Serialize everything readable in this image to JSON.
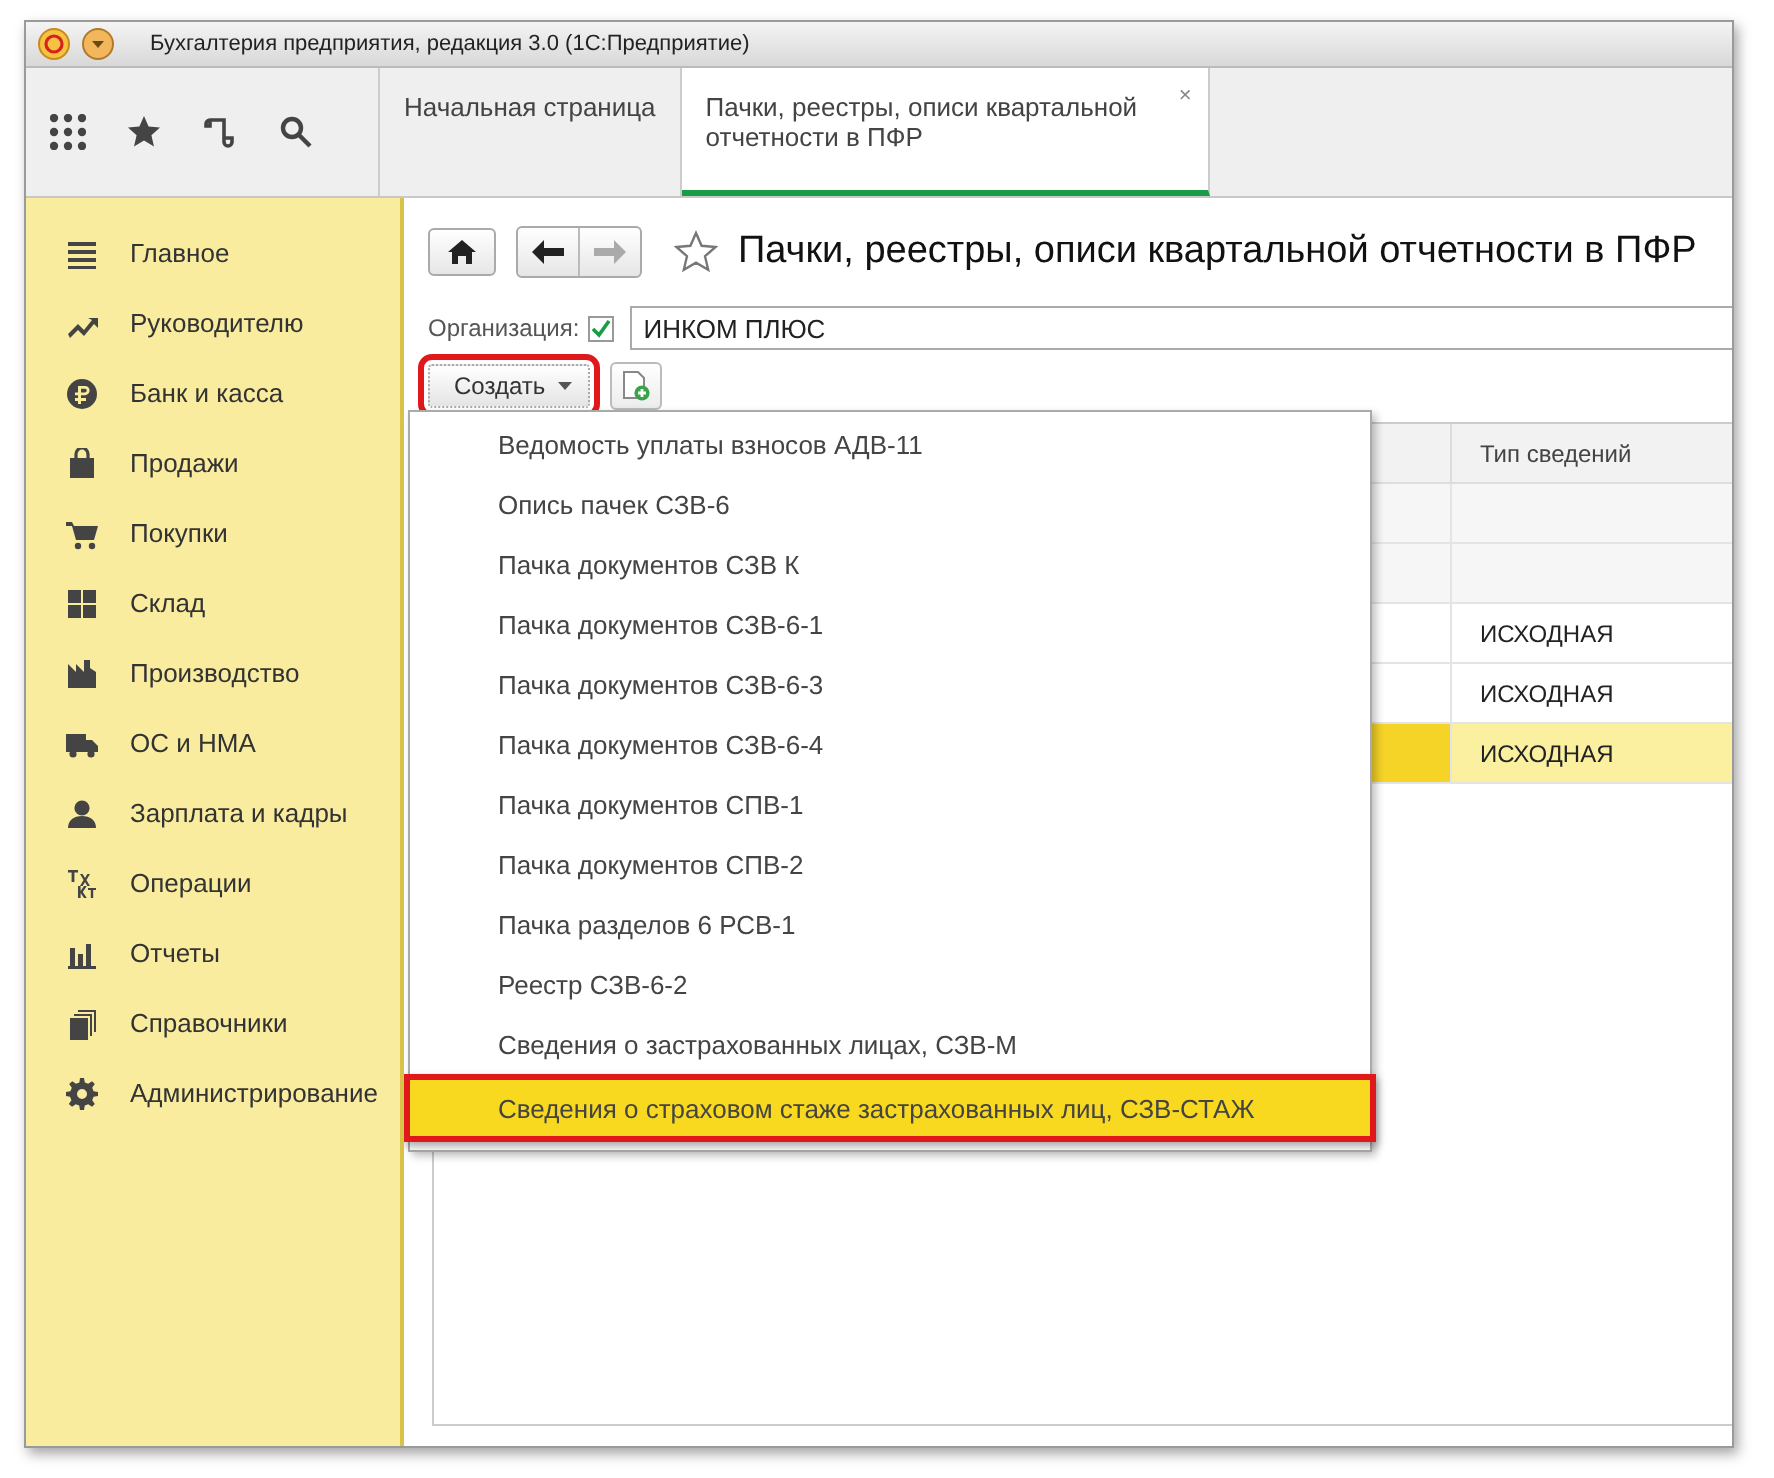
{
  "window": {
    "title": "Бухгалтерия предприятия, редакция 3.0  (1С:Предприятие)"
  },
  "tabs": [
    {
      "label": "Начальная страница",
      "selected": false
    },
    {
      "label": "Пачки, реестры, описи квартальной отчетности в ПФР",
      "selected": true,
      "close": "×"
    }
  ],
  "sidebar": {
    "items": [
      {
        "label": "Главное"
      },
      {
        "label": "Руководителю"
      },
      {
        "label": "Банк и касса"
      },
      {
        "label": "Продажи"
      },
      {
        "label": "Покупки"
      },
      {
        "label": "Склад"
      },
      {
        "label": "Производство"
      },
      {
        "label": "ОС и НМА"
      },
      {
        "label": "Зарплата и кадры"
      },
      {
        "label": "Операции"
      },
      {
        "label": "Отчеты"
      },
      {
        "label": "Справочники"
      },
      {
        "label": "Администрирование"
      }
    ]
  },
  "page": {
    "title": "Пачки, реестры, описи квартальной отчетности в ПФР",
    "favorite": false
  },
  "organization": {
    "label": "Организация:",
    "checked": true,
    "value": "ИНКОМ ПЛЮС"
  },
  "create_button": {
    "label": "Создать",
    "highlighted": true
  },
  "create_menu": [
    {
      "label": "Ведомость уплаты взносов АДВ-11",
      "selected": false
    },
    {
      "label": "Опись пачек СЗВ-6",
      "selected": false
    },
    {
      "label": "Пачка документов СЗВ К",
      "selected": false
    },
    {
      "label": "Пачка документов СЗВ-6-1",
      "selected": false
    },
    {
      "label": "Пачка документов СЗВ-6-3",
      "selected": false
    },
    {
      "label": "Пачка документов СЗВ-6-4",
      "selected": false
    },
    {
      "label": "Пачка документов СПВ-1",
      "selected": false
    },
    {
      "label": "Пачка документов СПВ-2",
      "selected": false
    },
    {
      "label": "Пачка разделов 6 РСВ-1",
      "selected": false
    },
    {
      "label": "Реестр СЗВ-6-2",
      "selected": false
    },
    {
      "label": "Сведения о застрахованных лицах, СЗВ-М",
      "selected": false
    },
    {
      "label": "Сведения о страховом стаже застрахованных лиц, СЗВ-СТАЖ",
      "selected": true
    }
  ],
  "table": {
    "columns": [
      "Тип сведений"
    ],
    "rows": [
      {
        "kind": "group",
        "cells": [],
        "selected": false
      },
      {
        "kind": "group",
        "cells": [],
        "selected": false
      },
      {
        "kind": "row",
        "cells": [
          "ИСХОДНАЯ"
        ],
        "selected": false
      },
      {
        "kind": "row",
        "cells": [
          "ИСХОДНАЯ"
        ],
        "selected": false
      },
      {
        "kind": "row",
        "cells": [
          "ИСХОДНАЯ"
        ],
        "selected": true
      }
    ]
  }
}
